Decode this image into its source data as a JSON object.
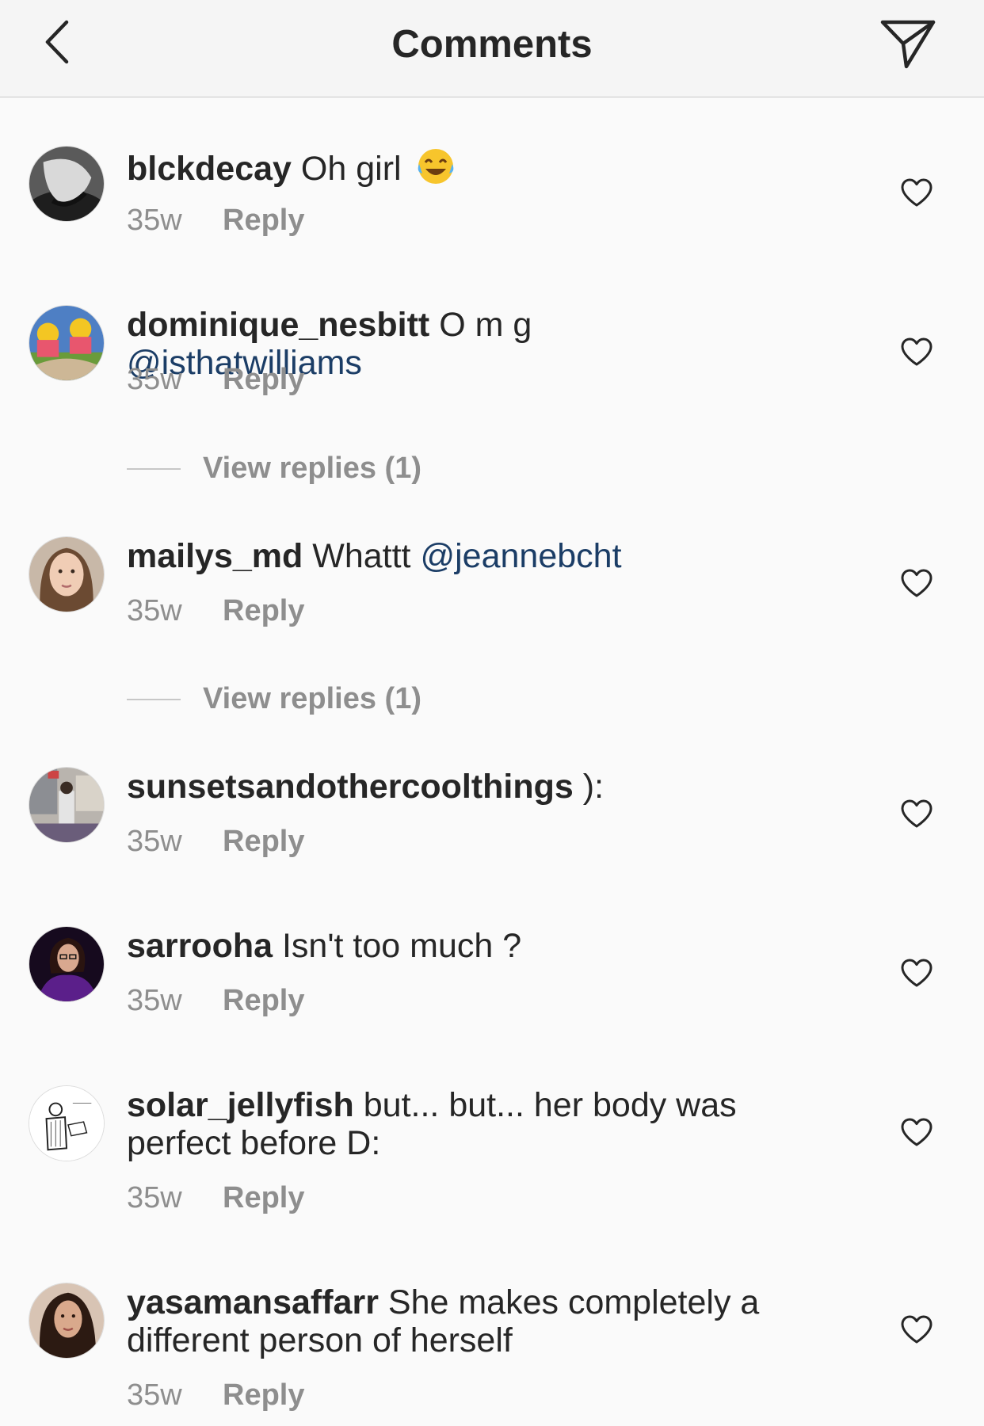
{
  "header": {
    "title": "Comments",
    "back_icon": "chevron-left-icon",
    "send_icon": "paper-plane-icon"
  },
  "colors": {
    "header_bg": "#f5f5f5",
    "background": "#fafafa",
    "text": "#262626",
    "secondary": "#8e8e8e",
    "mention": "#1b3d66"
  },
  "comments": [
    {
      "username": "blckdecay",
      "text": "Oh girl",
      "emoji": "face-with-tears-of-joy-emoji",
      "time": "35w",
      "reply_label": "Reply",
      "like_icon": "heart-outline-icon"
    },
    {
      "username": "dominique_nesbitt",
      "text": "O m g",
      "mention": "@isthatwilliams",
      "time": "35w",
      "reply_label": "Reply",
      "like_icon": "heart-outline-icon",
      "view_replies": "View replies (1)"
    },
    {
      "username": "mailys_md",
      "text": "Whattt",
      "mention": "@jeannebcht",
      "time": "35w",
      "reply_label": "Reply",
      "like_icon": "heart-outline-icon",
      "view_replies": "View replies (1)"
    },
    {
      "username": "sunsetsandothercoolthings",
      "text": "):",
      "time": "35w",
      "reply_label": "Reply",
      "like_icon": "heart-outline-icon"
    },
    {
      "username": "sarrooha",
      "text": "Isn't too much ?",
      "time": "35w",
      "reply_label": "Reply",
      "like_icon": "heart-outline-icon"
    },
    {
      "username": "solar_jellyfish",
      "text": "but... but... her body was perfect before D:",
      "time": "35w",
      "reply_label": "Reply",
      "like_icon": "heart-outline-icon"
    },
    {
      "username": "yasamansaffarr",
      "text": "She makes completely a different person of herself",
      "time": "35w",
      "reply_label": "Reply",
      "like_icon": "heart-outline-icon"
    }
  ]
}
